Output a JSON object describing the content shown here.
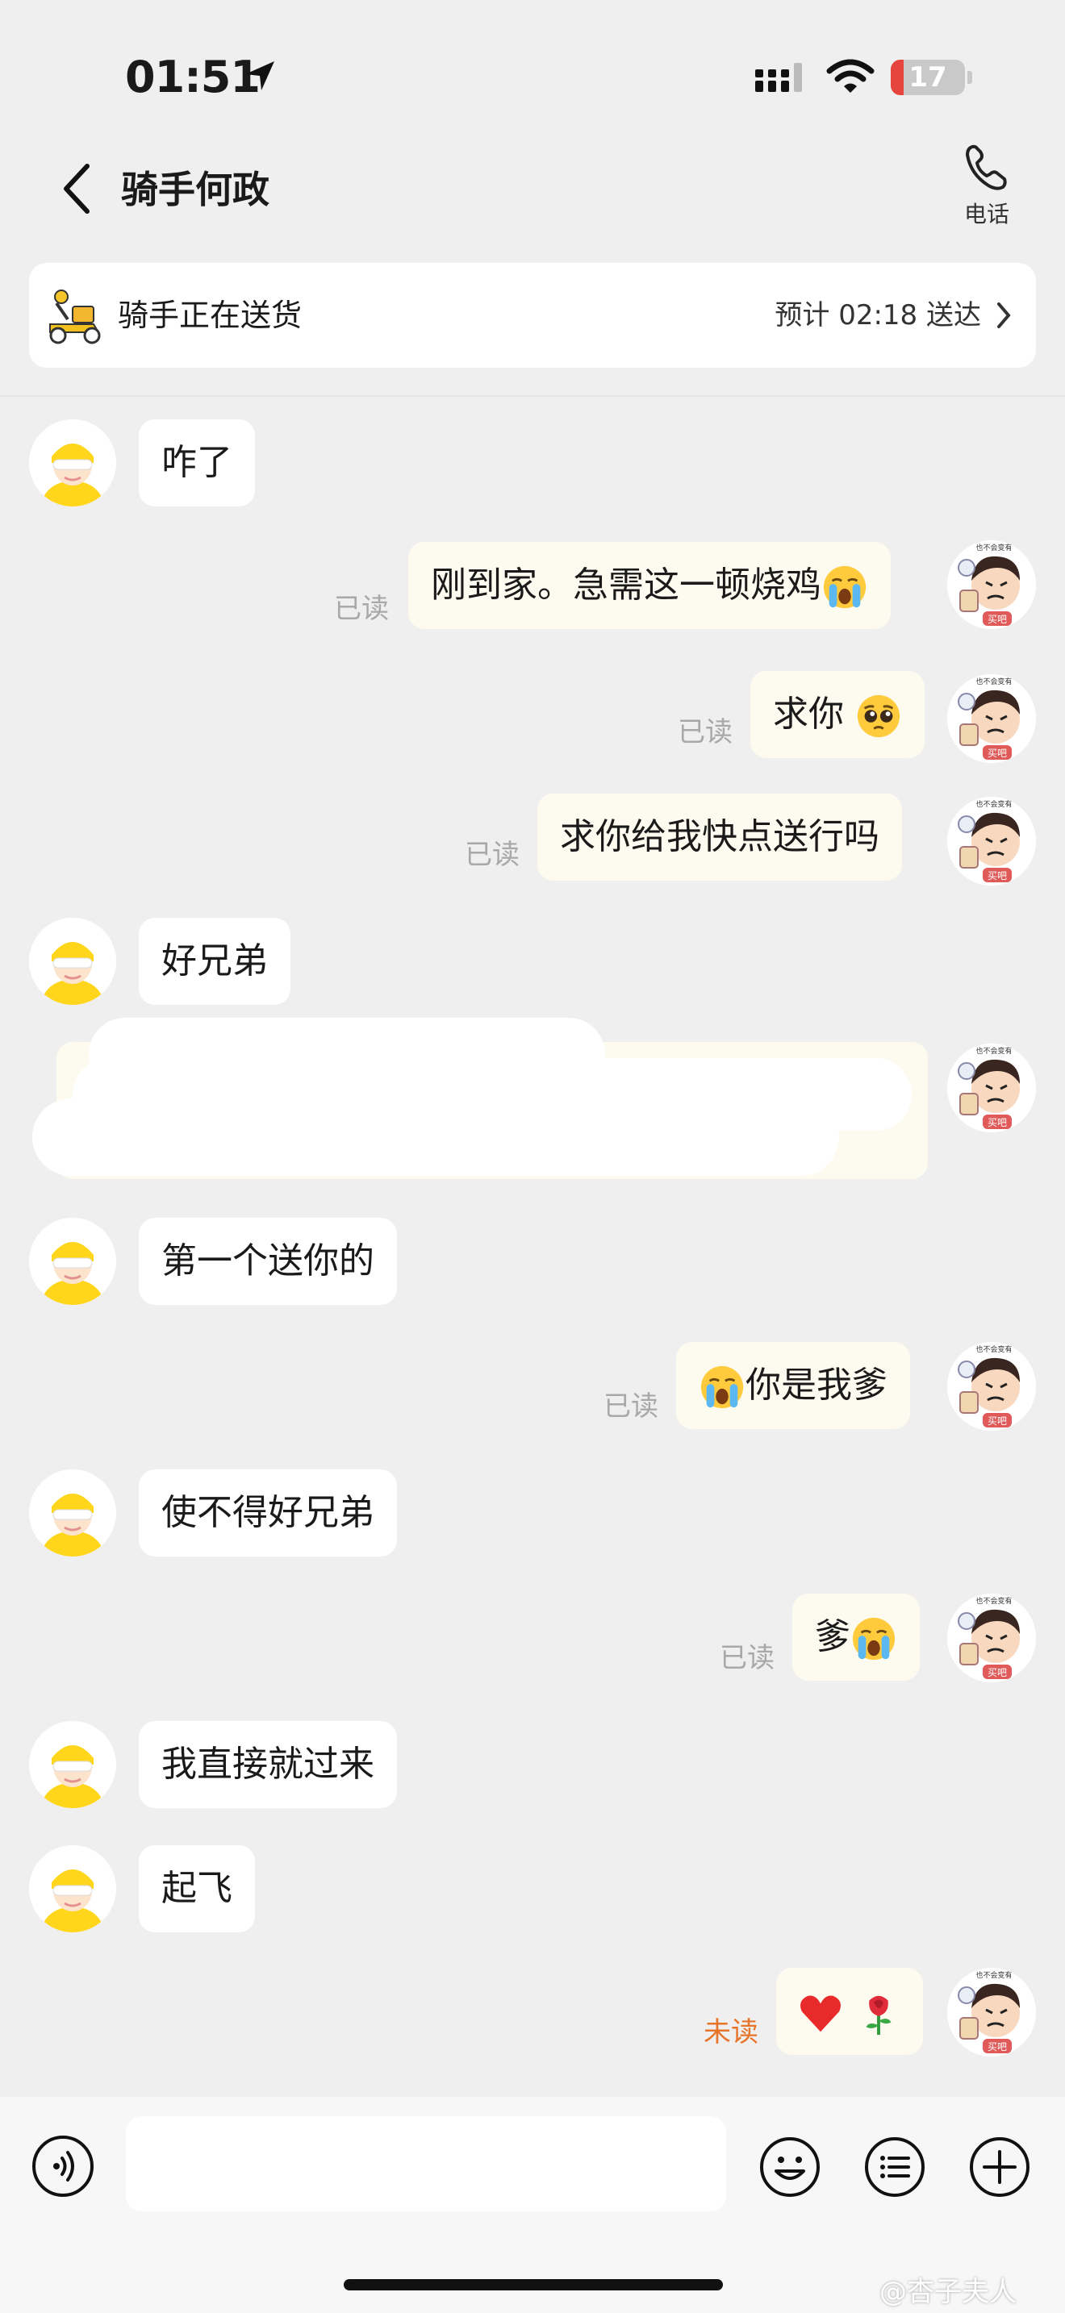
{
  "status_bar": {
    "time": "01:51",
    "battery_level": 17,
    "battery_text": "17",
    "battery_color": "#e5453c",
    "icons": [
      "location-arrow-icon",
      "signal-icon",
      "wifi-icon",
      "battery-icon"
    ]
  },
  "header": {
    "title": "骑手何政",
    "call_label": "电话"
  },
  "delivery": {
    "status": "骑手正在送货",
    "eta": "预计 02:18 送达"
  },
  "colors": {
    "accent_unread": "#e8742a",
    "outgoing_bubble": "#fdfbef",
    "incoming_bubble": "#ffffff",
    "background": "#efefef"
  },
  "messages": [
    {
      "from": "rider",
      "text": "咋了"
    },
    {
      "from": "me",
      "text": "刚到家。急需这一顿烧鸡",
      "emoji_after": "loudly-crying-emoji",
      "read_label": "已读"
    },
    {
      "from": "me",
      "text": "求你",
      "emoji_after": "pleading-face-emoji",
      "read_label": "已读"
    },
    {
      "from": "me",
      "text": "求你给我快点送行吗",
      "read_label": "已读"
    },
    {
      "from": "rider",
      "text": "好兄弟"
    },
    {
      "from": "me",
      "text": "",
      "redacted": true
    },
    {
      "from": "rider",
      "text": "第一个送你的"
    },
    {
      "from": "me",
      "text": "你是我爹",
      "emoji_before": "loudly-crying-emoji",
      "read_label": "已读"
    },
    {
      "from": "rider",
      "text": "使不得好兄弟"
    },
    {
      "from": "me",
      "text": "爹",
      "emoji_after": "loudly-crying-emoji",
      "read_label": "已读"
    },
    {
      "from": "rider",
      "text": "我直接就过来"
    },
    {
      "from": "rider",
      "text": "起飞"
    },
    {
      "from": "me",
      "text": "",
      "emojis": [
        "red-heart-emoji",
        "rose-emoji"
      ],
      "read_label": "未读"
    }
  ],
  "input": {
    "value": "",
    "placeholder": ""
  },
  "watermark": "@杏子夫人"
}
